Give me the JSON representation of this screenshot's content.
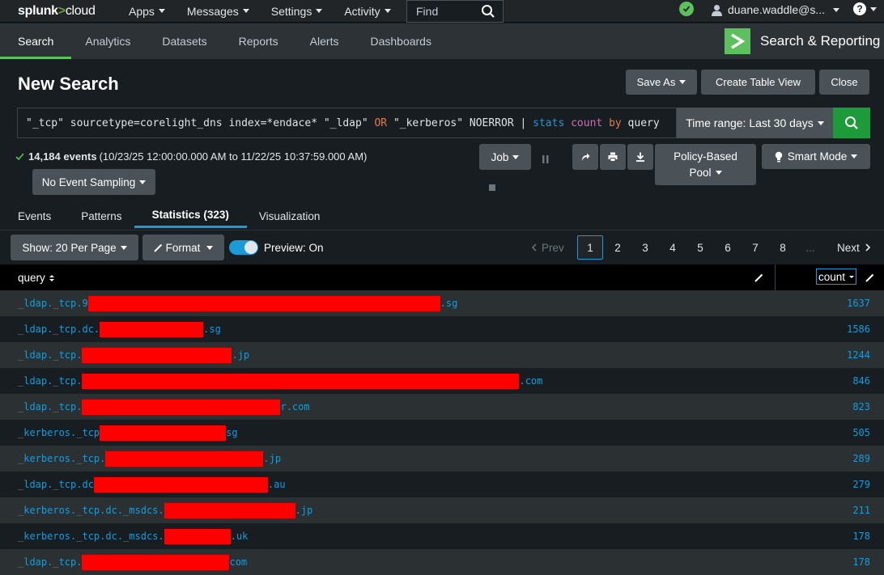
{
  "topbar": {
    "logo_main": "splunk",
    "logo_gt": ">",
    "logo_sub": "cloud",
    "nav": [
      "Apps",
      "Messages",
      "Settings",
      "Activity"
    ],
    "find_placeholder": "Find",
    "user": "duane.waddle@s...",
    "status_color": "#5cc05c"
  },
  "appbar": {
    "tabs": [
      "Search",
      "Analytics",
      "Datasets",
      "Reports",
      "Alerts",
      "Dashboards"
    ],
    "active_tab": "Search",
    "app_title": "Search & Reporting"
  },
  "search": {
    "title": "New Search",
    "save_as": "Save As",
    "create_table_view": "Create Table View",
    "close": "Close",
    "query_parts": {
      "p1": "\"_tcp\" sourcetype=corelight_dns index=*endace* \"_ldap\" ",
      "or": "OR",
      "p2": " \"_kerberos\" NOERROR | ",
      "cmd": "stats",
      "fn": "count",
      "by": "by",
      "p3": " query"
    },
    "time_range": "Time range: Last 30 days"
  },
  "results": {
    "event_count": "14,184 events",
    "range": "(10/23/25 12:00:00.000 AM to 11/22/25 10:37:59.000 AM)",
    "sampling": "No Event Sampling",
    "job": "Job",
    "policy_line1": "Policy-Based",
    "policy_line2": "Pool",
    "mode": "Smart Mode"
  },
  "tabs": [
    {
      "label": "Events"
    },
    {
      "label": "Patterns"
    },
    {
      "label": "Statistics (323)"
    },
    {
      "label": "Visualization"
    }
  ],
  "controls": {
    "per_page": "Show: 20 Per Page",
    "format": "Format",
    "preview": "Preview: On",
    "prev": "Prev",
    "pages": [
      "1",
      "2",
      "3",
      "4",
      "5",
      "6",
      "7",
      "8",
      "..."
    ],
    "next": "Next"
  },
  "table": {
    "col_query": "query",
    "col_count": "count",
    "rows": [
      {
        "prefix": "_ldap._tcp.9",
        "suffix": ".sg",
        "count": "1637",
        "redact_w": 435
      },
      {
        "prefix": "_ldap._tcp.dc.",
        "suffix": ".sg",
        "count": "1586",
        "redact_w": 128
      },
      {
        "prefix": "_ldap._tcp.",
        "suffix": ".jp",
        "count": "1244",
        "redact_w": 185
      },
      {
        "prefix": "_ldap._tcp.",
        "suffix": ".com",
        "count": "846",
        "redact_w": 540
      },
      {
        "prefix": "_ldap._tcp.",
        "suffix": "r.com",
        "count": "823",
        "redact_w": 245
      },
      {
        "prefix": "_kerberos._tcp",
        "suffix": "sg",
        "count": "505",
        "redact_w": 156
      },
      {
        "prefix": "_kerberos._tcp.",
        "suffix": ".jp",
        "count": "289",
        "redact_w": 195
      },
      {
        "prefix": "_ldap._tcp.dc",
        "suffix": ".au",
        "count": "279",
        "redact_w": 215
      },
      {
        "prefix": "_kerberos._tcp.dc._msdcs.",
        "suffix": ".jp",
        "count": "211",
        "redact_w": 162
      },
      {
        "prefix": "_kerberos._tcp.dc._msdcs.",
        "suffix": ".uk",
        "count": "178",
        "redact_w": 82
      },
      {
        "prefix": "_ldap._tcp.",
        "suffix": "com",
        "count": "178",
        "redact_w": 182
      }
    ]
  }
}
